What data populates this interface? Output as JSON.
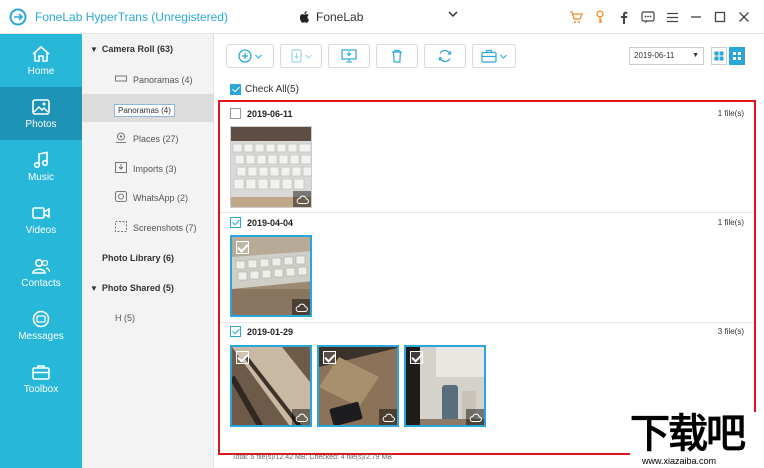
{
  "app": {
    "title": "FoneLab HyperTrans (Unregistered)",
    "device": "FoneLab",
    "window_icons": [
      "cart-icon",
      "key-icon",
      "facebook-icon",
      "feedback-icon",
      "menu-icon",
      "minimize-icon",
      "maximize-icon",
      "close-icon"
    ]
  },
  "sidebar": {
    "items": [
      {
        "label": "Home",
        "icon": "home-icon"
      },
      {
        "label": "Photos",
        "icon": "photos-icon"
      },
      {
        "label": "Music",
        "icon": "music-icon"
      },
      {
        "label": "Videos",
        "icon": "video-icon"
      },
      {
        "label": "Contacts",
        "icon": "contacts-icon"
      },
      {
        "label": "Messages",
        "icon": "messages-icon"
      },
      {
        "label": "Toolbox",
        "icon": "toolbox-icon"
      }
    ],
    "active": "Photos"
  },
  "tree": {
    "camera_roll": "Camera Roll (63)",
    "items": [
      {
        "label": "Panoramas (4)",
        "icon": "panorama-icon"
      },
      {
        "label": "",
        "icon": ""
      },
      {
        "label": "Places (27)",
        "icon": "places-icon"
      },
      {
        "label": "Imports (3)",
        "icon": "imports-icon"
      },
      {
        "label": "WhatsApp (2)",
        "icon": "whatsapp-icon"
      },
      {
        "label": "Screenshots (7)",
        "icon": "screenshots-icon"
      }
    ],
    "drag_ghost": "Panoramas (4)",
    "photo_library": "Photo Library (6)",
    "photo_shared": "Photo Shared (5)",
    "shared_items": [
      "H (5)"
    ]
  },
  "toolbar": {
    "buttons": [
      "add-icon",
      "export-to-device-icon",
      "export-to-pc-icon",
      "delete-icon",
      "refresh-icon",
      "toolbox-icon"
    ],
    "date_filter": "2019-06-11"
  },
  "check_all": "Check All(5)",
  "groups": [
    {
      "date": "2019-06-11",
      "count": "1 file(s)",
      "checked": false
    },
    {
      "date": "2019-04-04",
      "count": "1 file(s)",
      "checked": true
    },
    {
      "date": "2019-01-29",
      "count": "3 file(s)",
      "checked": true
    }
  ],
  "footer": "Total: 5 file(s)/12.42 MB; Checked: 4 file(s)/2.79 MB",
  "watermark": {
    "big": "下载吧",
    "small": "www.xiazaiba.com"
  },
  "colors": {
    "accent": "#2aa7d8",
    "sidebar": "#27b7d8",
    "sidebar_active": "#1e93b6",
    "highlight_border": "#e0141a"
  }
}
